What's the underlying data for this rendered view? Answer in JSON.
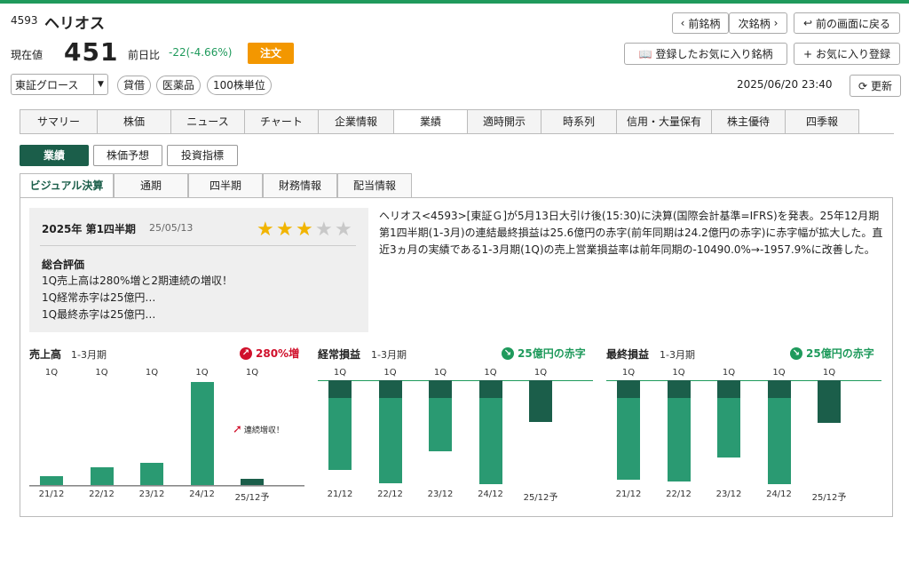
{
  "header": {
    "code": "4593",
    "name": "ヘリオス",
    "price_label": "現在値",
    "price": "451",
    "diff_label": "前日比",
    "diff": "-22(-4.66%)",
    "order_label": "注文",
    "prev_label": "前銘柄",
    "next_label": "次銘柄",
    "back_label": "前の画面に戻る",
    "fav_list_label": "登録したお気に入り銘柄",
    "fav_add_label": "お気に入り登録",
    "market": "東証グロース",
    "chips": [
      "貸借",
      "医薬品",
      "100株単位"
    ],
    "datetime": "2025/06/20 23:40",
    "refresh_label": "更新"
  },
  "tabs": [
    "サマリー",
    "株価",
    "ニュース",
    "チャート",
    "企業情報",
    "業績",
    "適時開示",
    "時系列",
    "信用・大量保有",
    "株主優待",
    "四季報"
  ],
  "active_tab": "業績",
  "subbuttons": [
    "業績",
    "株価予想",
    "投資指標"
  ],
  "viewtabs": [
    "ビジュアル決算",
    "通期",
    "四半期",
    "財務情報",
    "配当情報"
  ],
  "summary": {
    "period": "2025年 第1四半期",
    "date": "25/05/13",
    "rating": 3,
    "rating_max": 5,
    "eval_title": "総合評価",
    "lines": [
      "1Q売上高は280%増と2期連続の増収！",
      "1Q経常赤字は25億円…",
      "1Q最終赤字は25億円…"
    ]
  },
  "description": "ヘリオス<4593>[東証Ｇ]が5月13日大引け後(15:30)に決算(国際会計基準=IFRS)を発表。25年12月期第1四半期(1-3月)の連結最終損益は25.6億円の赤字(前年同期は24.2億円の赤字)に赤字幅が拡大した。直近3ヵ月の実績である1-3月期(1Q)の売上営業損益率は前年同期の-10490.0%→-1957.9%に改善した。",
  "colors": {
    "green": "#1f9a5c",
    "bar_light": "#2a9a72",
    "bar_dark": "#1b5e4a",
    "up_red": "#d0102b",
    "down_green": "#1f9a5c"
  },
  "charts": {
    "sales": {
      "title": "売上高",
      "period": "1-3月期",
      "badge": "280%増",
      "annotation": "連続増収！"
    },
    "ordinary": {
      "title": "経常損益",
      "period": "1-3月期",
      "badge": "25億円の赤字"
    },
    "net": {
      "title": "最終損益",
      "period": "1-3月期",
      "badge": "25億円の赤字"
    }
  },
  "chart_data": [
    {
      "type": "bar",
      "title": "売上高",
      "categories": [
        "21/12",
        "22/12",
        "23/12",
        "24/12",
        "25/12予"
      ],
      "quarter_labels": [
        "1Q",
        "1Q",
        "1Q",
        "1Q",
        "1Q"
      ],
      "values": [
        10,
        20,
        25,
        118,
        7
      ],
      "ylim": [
        0,
        120
      ]
    },
    {
      "type": "bar",
      "title": "経常損益",
      "categories": [
        "21/12",
        "22/12",
        "23/12",
        "24/12",
        "25/12予"
      ],
      "quarter_labels": [
        "1Q",
        "1Q",
        "1Q",
        "1Q",
        "1Q"
      ],
      "values": [
        -103,
        -118,
        -81,
        -119,
        -48
      ],
      "ylim": [
        -120,
        0
      ]
    },
    {
      "type": "bar",
      "title": "最終損益",
      "categories": [
        "21/12",
        "22/12",
        "23/12",
        "24/12",
        "25/12予"
      ],
      "quarter_labels": [
        "1Q",
        "1Q",
        "1Q",
        "1Q",
        "1Q"
      ],
      "values": [
        -114,
        -116,
        -88,
        -119,
        -49
      ],
      "ylim": [
        -120,
        0
      ]
    }
  ]
}
